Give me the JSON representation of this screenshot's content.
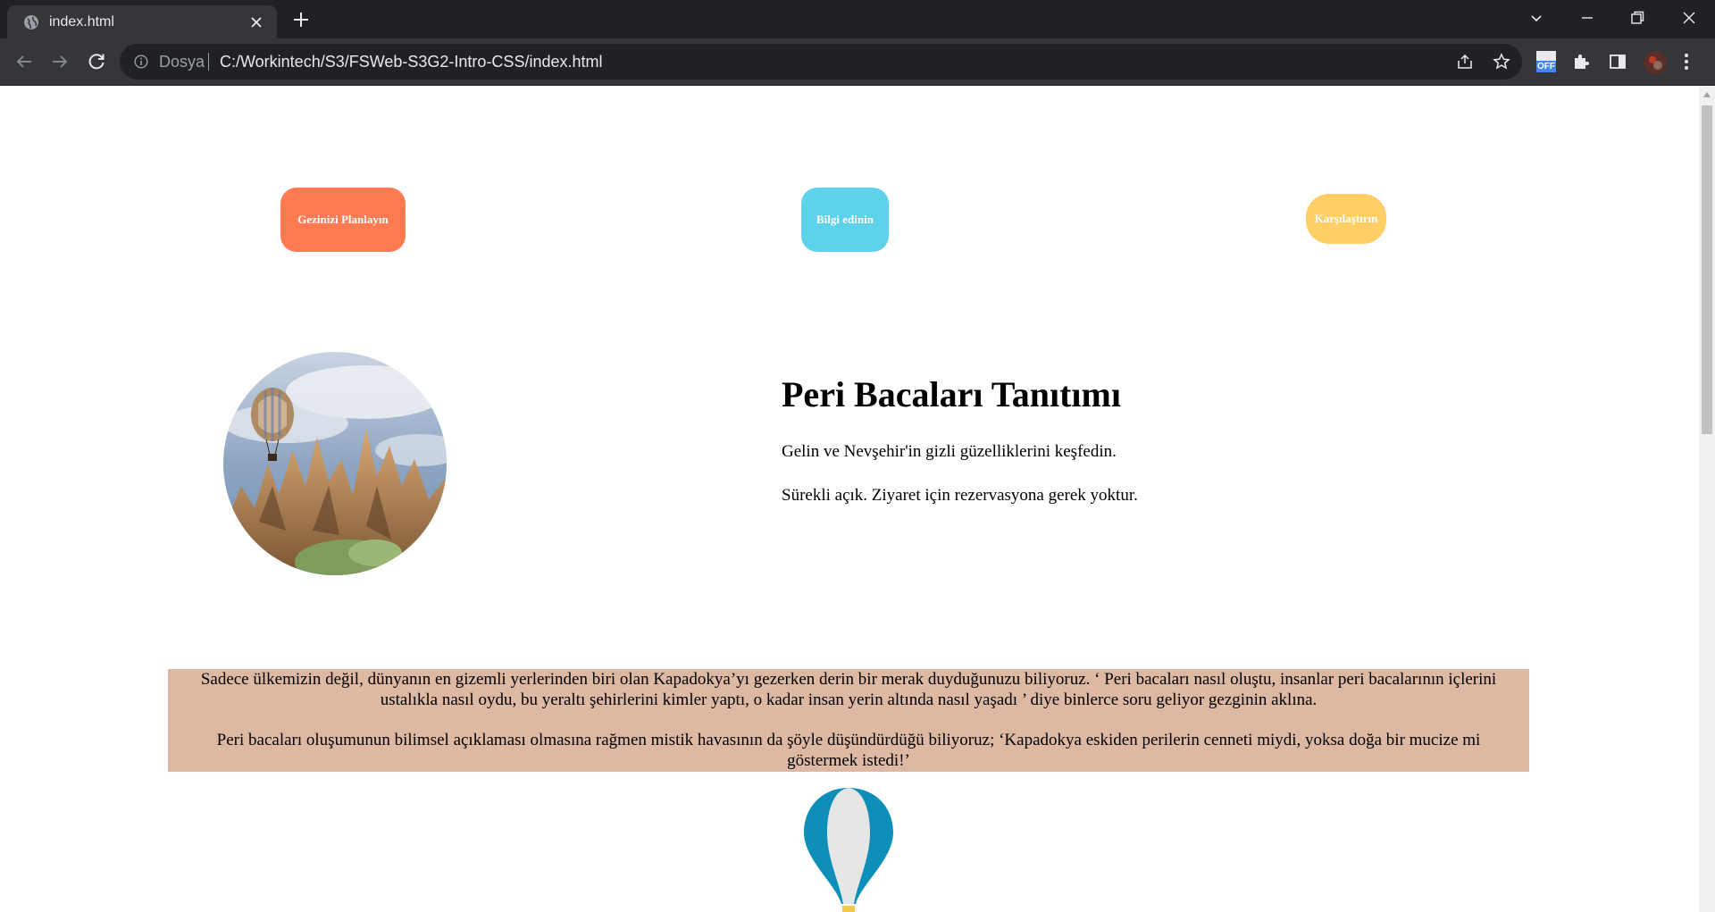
{
  "browser": {
    "tab_title": "index.html",
    "scheme_label": "Dosya",
    "url": "C:/Workintech/S3/FSWeb-S3G2-Intro-CSS/index.html",
    "extension_badge": "OFF"
  },
  "actions": {
    "plan_label": "Gezinizi Planlayın",
    "info_label": "Bilgi edinin",
    "compare_label": "Karşılaştırın"
  },
  "intro": {
    "heading": "Peri Bacaları Tanıtımı",
    "line1": "Gelin ve Nevşehir'in gizli güzelliklerini keşfedin.",
    "line2": "Sürekli açık. Ziyaret için rezervasyona gerek yoktur."
  },
  "story": {
    "paragraph1": "Sadece ülkemizin değil, dünyanın en gizemli yerlerinden biri olan Kapadokya’yı gezerken derin bir merak duyduğunuzu biliyoruz. ‘ Peri bacaları nasıl oluştu, insanlar peri bacalarının içlerini ustalıkla nasıl oydu, bu yeraltı şehirlerini kimler yaptı, o kadar insan yerin altında nasıl yaşadı ’ diye binlerce soru geliyor gezginin aklına.",
    "paragraph2": "Peri bacaları oluşumunun bilimsel açıklaması olmasına rağmen mistik havasının da şöyle düşündürdüğü biliyoruz; ‘Kapadokya eskiden perilerin cenneti miydi, yoksa doğa bir mucize mi göstermek istedi!’"
  },
  "colors": {
    "plan_button": "#ff7a51",
    "info_button": "#5ed2ea",
    "compare_button": "#ffce65",
    "story_background": "#ddb8a3"
  }
}
